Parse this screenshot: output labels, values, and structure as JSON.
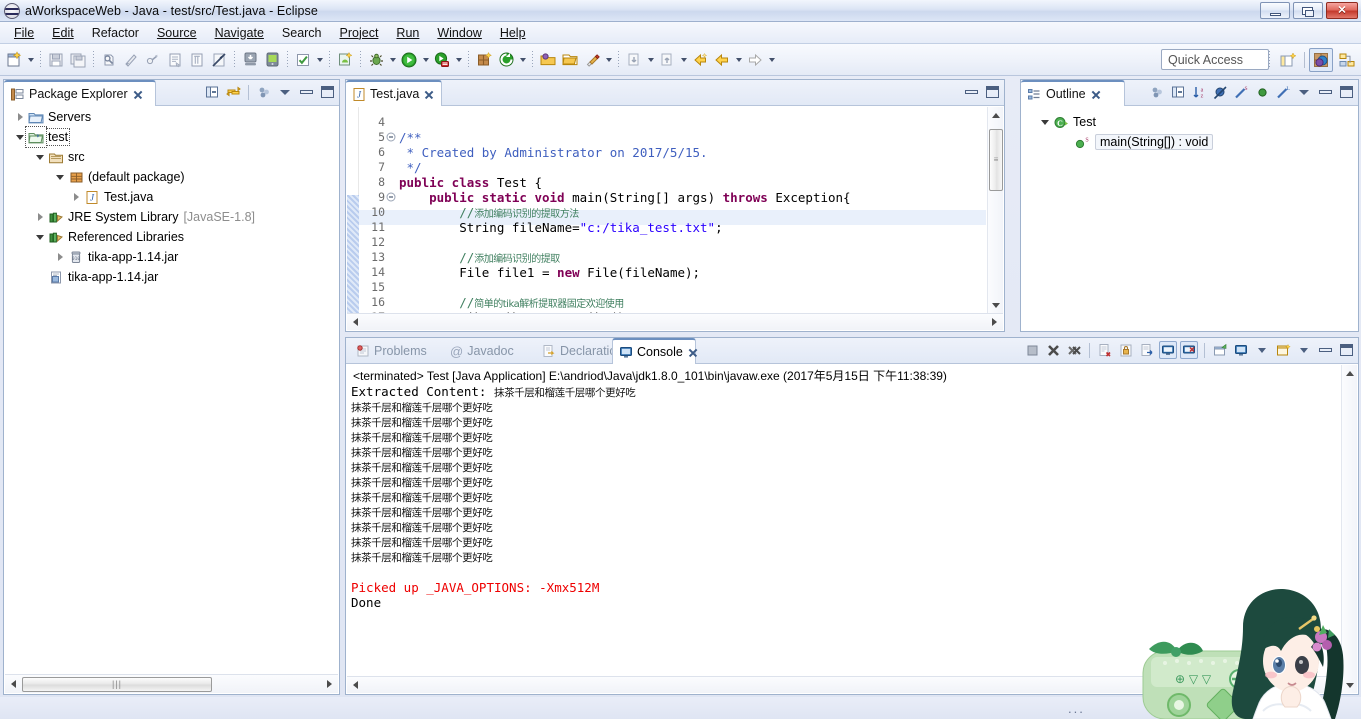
{
  "window": {
    "title": "aWorkspaceWeb - Java - test/src/Test.java - Eclipse",
    "app_icon": "eclipse-icon",
    "buttons": {
      "minimize": "minimize-button",
      "maximize": "maximize-button",
      "close": "close-button"
    }
  },
  "menubar": [
    {
      "label": "File",
      "mnemonic": "F"
    },
    {
      "label": "Edit",
      "mnemonic": "E"
    },
    {
      "label": "Refactor",
      "mnemonic": ""
    },
    {
      "label": "Source",
      "mnemonic": "S"
    },
    {
      "label": "Navigate",
      "mnemonic": "N"
    },
    {
      "label": "Search",
      "mnemonic": "a"
    },
    {
      "label": "Project",
      "mnemonic": "P"
    },
    {
      "label": "Run",
      "mnemonic": "R"
    },
    {
      "label": "Window",
      "mnemonic": "W"
    },
    {
      "label": "Help",
      "mnemonic": "H"
    }
  ],
  "toolbar": {
    "quick_access_placeholder": "Quick Access",
    "buttons": [
      "new-wizard-icon",
      "save-icon",
      "save-all-icon",
      "print-icon",
      "new-java-package-icon",
      "toggle-markers-icon",
      "open-type-icon",
      "new-annotation-icon",
      "show-whitespace-icon",
      "skip-breakpoints-icon",
      "android-sdk-manager-icon",
      "android-avd-manager-icon",
      "check-icon",
      "new-android-project-icon",
      "debug-icon",
      "run-icon",
      "coverage-icon",
      "new-junit-icon",
      "run-last-icon",
      "open-package-icon",
      "open-folder-icon",
      "search-icon",
      "next-annotation-icon",
      "previous-annotation-icon",
      "back-icon",
      "forward-icon"
    ],
    "perspective": {
      "open_perspective": "open-perspective-icon",
      "java_perspective": "java-perspective-icon",
      "ddms_perspective": "ddms-perspective-icon"
    }
  },
  "package_explorer": {
    "title": "Package Explorer",
    "actions": [
      "collapse-all-icon",
      "link-with-editor-icon",
      "view-menu-icon",
      "minimize-icon",
      "maximize-icon"
    ],
    "tree": [
      {
        "label": "Servers",
        "icon": "folder-icon",
        "indent": 0,
        "state": "collapsed",
        "selected": false
      },
      {
        "label": "test",
        "icon": "java-project-icon",
        "indent": 0,
        "state": "expanded",
        "selected": true
      },
      {
        "label": "src",
        "icon": "source-folder-icon",
        "indent": 1,
        "state": "expanded",
        "selected": false
      },
      {
        "label": "(default package)",
        "icon": "package-icon",
        "indent": 2,
        "state": "expanded",
        "selected": false
      },
      {
        "label": "Test.java",
        "icon": "java-file-icon",
        "indent": 3,
        "state": "collapsed",
        "selected": false
      },
      {
        "label": "JRE System Library",
        "suffix": "[JavaSE-1.8]",
        "icon": "library-icon",
        "indent": 1,
        "state": "collapsed",
        "selected": false
      },
      {
        "label": "Referenced Libraries",
        "icon": "library-icon",
        "indent": 1,
        "state": "expanded",
        "selected": false
      },
      {
        "label": "tika-app-1.14.jar",
        "icon": "jar-icon",
        "indent": 2,
        "state": "collapsed",
        "selected": false
      },
      {
        "label": "tika-app-1.14.jar",
        "icon": "jar-file-icon",
        "indent": 1,
        "state": "leaf",
        "selected": false
      }
    ]
  },
  "editor": {
    "tab_label": "Test.java",
    "tab_icon": "java-file-icon",
    "actions": [
      "minimize-icon",
      "maximize-icon"
    ],
    "highlighted_line": 11,
    "lines": [
      {
        "no": 4,
        "fold": "",
        "segments": []
      },
      {
        "no": 5,
        "fold": "collapse",
        "segments": [
          {
            "t": "/**",
            "c": "jdoc"
          }
        ]
      },
      {
        "no": 6,
        "fold": "",
        "segments": [
          {
            "t": " * Created by Administrator on 2017/5/15.",
            "c": "jdoc"
          }
        ]
      },
      {
        "no": 7,
        "fold": "",
        "segments": [
          {
            "t": " */",
            "c": "jdoc"
          }
        ]
      },
      {
        "no": 8,
        "fold": "",
        "segments": [
          {
            "t": "public class ",
            "c": "kw"
          },
          {
            "t": "Test {",
            "c": "plain"
          }
        ]
      },
      {
        "no": 9,
        "fold": "collapse",
        "segments": [
          {
            "t": "    ",
            "c": "plain"
          },
          {
            "t": "public static void ",
            "c": "kw"
          },
          {
            "t": "main(String[] args) ",
            "c": "plain"
          },
          {
            "t": "throws ",
            "c": "kw"
          },
          {
            "t": "Exception{",
            "c": "plain"
          }
        ]
      },
      {
        "no": 10,
        "fold": "",
        "segments": [
          {
            "t": "        //",
            "c": "cmt"
          },
          {
            "t": "添加编码识别的提取方法",
            "c": "cjk"
          }
        ]
      },
      {
        "no": 11,
        "fold": "",
        "segments": [
          {
            "t": "        String fileName=",
            "c": "plain"
          },
          {
            "t": "\"c:/tika_test.txt\"",
            "c": "str"
          },
          {
            "t": ";",
            "c": "plain"
          }
        ]
      },
      {
        "no": 12,
        "fold": "",
        "segments": []
      },
      {
        "no": 13,
        "fold": "",
        "segments": [
          {
            "t": "        //",
            "c": "cmt"
          },
          {
            "t": "添加编码识别的提取",
            "c": "cjk"
          }
        ]
      },
      {
        "no": 14,
        "fold": "",
        "segments": [
          {
            "t": "        File file1 = ",
            "c": "plain"
          },
          {
            "t": "new ",
            "c": "kw"
          },
          {
            "t": "File(fileName);",
            "c": "plain"
          }
        ]
      },
      {
        "no": 15,
        "fold": "",
        "segments": []
      },
      {
        "no": 16,
        "fold": "",
        "segments": [
          {
            "t": "        //",
            "c": "cmt"
          },
          {
            "t": "简单的tika解析提取器固定欢迎使用",
            "c": "cjk"
          }
        ]
      },
      {
        "no": 17,
        "fold": "",
        "segments": [
          {
            "t": "        Tika tika = ",
            "c": "plain"
          },
          {
            "t": "new ",
            "c": "kw"
          },
          {
            "t": "Tika();",
            "c": "plain"
          }
        ]
      }
    ]
  },
  "outline": {
    "title": "Outline",
    "actions": [
      "focus-on-active-task-icon",
      "collapse-all-icon",
      "sort-icon",
      "hide-fields-icon",
      "hide-static-icon",
      "hide-nonpublic-icon",
      "hide-local-types-icon",
      "view-menu-icon",
      "minimize-icon",
      "maximize-icon"
    ],
    "tree": [
      {
        "label": "Test",
        "icon": "class-icon",
        "indent": 0,
        "state": "expanded",
        "selected": false
      },
      {
        "label": "main(String[]) : void",
        "icon": "public-method-static-icon",
        "indent": 1,
        "state": "leaf",
        "selected": true
      }
    ]
  },
  "console": {
    "tabs": [
      {
        "label": "Problems",
        "icon": "problems-icon",
        "active": false
      },
      {
        "label": "Javadoc",
        "icon": "javadoc-icon",
        "active": false
      },
      {
        "label": "Declaration",
        "icon": "declaration-icon",
        "active": false
      },
      {
        "label": "Console",
        "icon": "console-icon",
        "active": true
      }
    ],
    "actions": [
      "terminate-icon",
      "remove-launch-icon",
      "remove-all-terminated-icon",
      "clear-console-icon",
      "scroll-lock-icon",
      "show-console-on-output-icon",
      "pin-console-icon",
      "display-selected-console-icon",
      "open-console-icon",
      "new-console-view-icon",
      "minimize-icon",
      "maximize-icon"
    ],
    "launch_header": "<terminated> Test [Java Application] E:\\andriod\\Java\\jdk1.8.0_101\\bin\\javaw.exe (2017年5月15日 下午11:38:39)",
    "output_label": "Extracted Content:",
    "output_cjk": "抹茶千层和榴莲千层哪个更好吃",
    "repeat_lines": 11,
    "warning_line": "Picked up _JAVA_OPTIONS: -Xmx512M",
    "final_line": "Done"
  },
  "colors": {
    "keyword": "#7f0055",
    "string": "#2a00ff",
    "comment": "#3f7f5f",
    "javadoc": "#3f5fbf",
    "error": "#ee0000",
    "tab_active_border": "#6c8fbf",
    "selection": "#e9f0fb",
    "panel_border": "#9fb2cd"
  },
  "status": {
    "dots": "..."
  }
}
